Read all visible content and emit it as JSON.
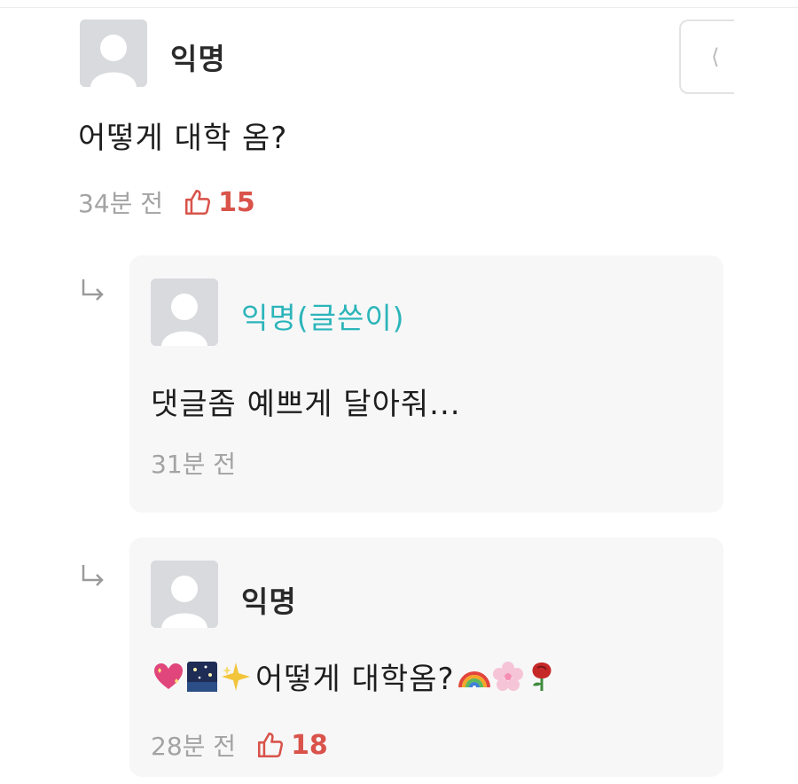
{
  "post": {
    "author": "익명",
    "text": "어떻게 대학 옴?",
    "time": "34분 전",
    "likes": "15"
  },
  "replies": [
    {
      "author": "익명(글쓴이)",
      "text": "댓글좀 예쁘게 달아줘...",
      "time": "31분 전"
    },
    {
      "author": "익명",
      "text": "어떻게 대학옴?",
      "time": "28분 전",
      "likes": "18",
      "emoji_prefix": [
        "sparkling-heart-icon",
        "night-sky-icon",
        "sparkle-star-icon"
      ],
      "emoji_suffix": [
        "rainbow-icon",
        "cherry-blossom-icon",
        "rose-icon"
      ]
    }
  ],
  "more_button_glyph": "⟨",
  "colors": {
    "author_accent": "#2bb5ba",
    "like_accent": "#d9534a",
    "meta_gray": "#a3a3a3",
    "reply_bg": "#f7f7f8",
    "avatar_bg": "#d9dadd"
  }
}
